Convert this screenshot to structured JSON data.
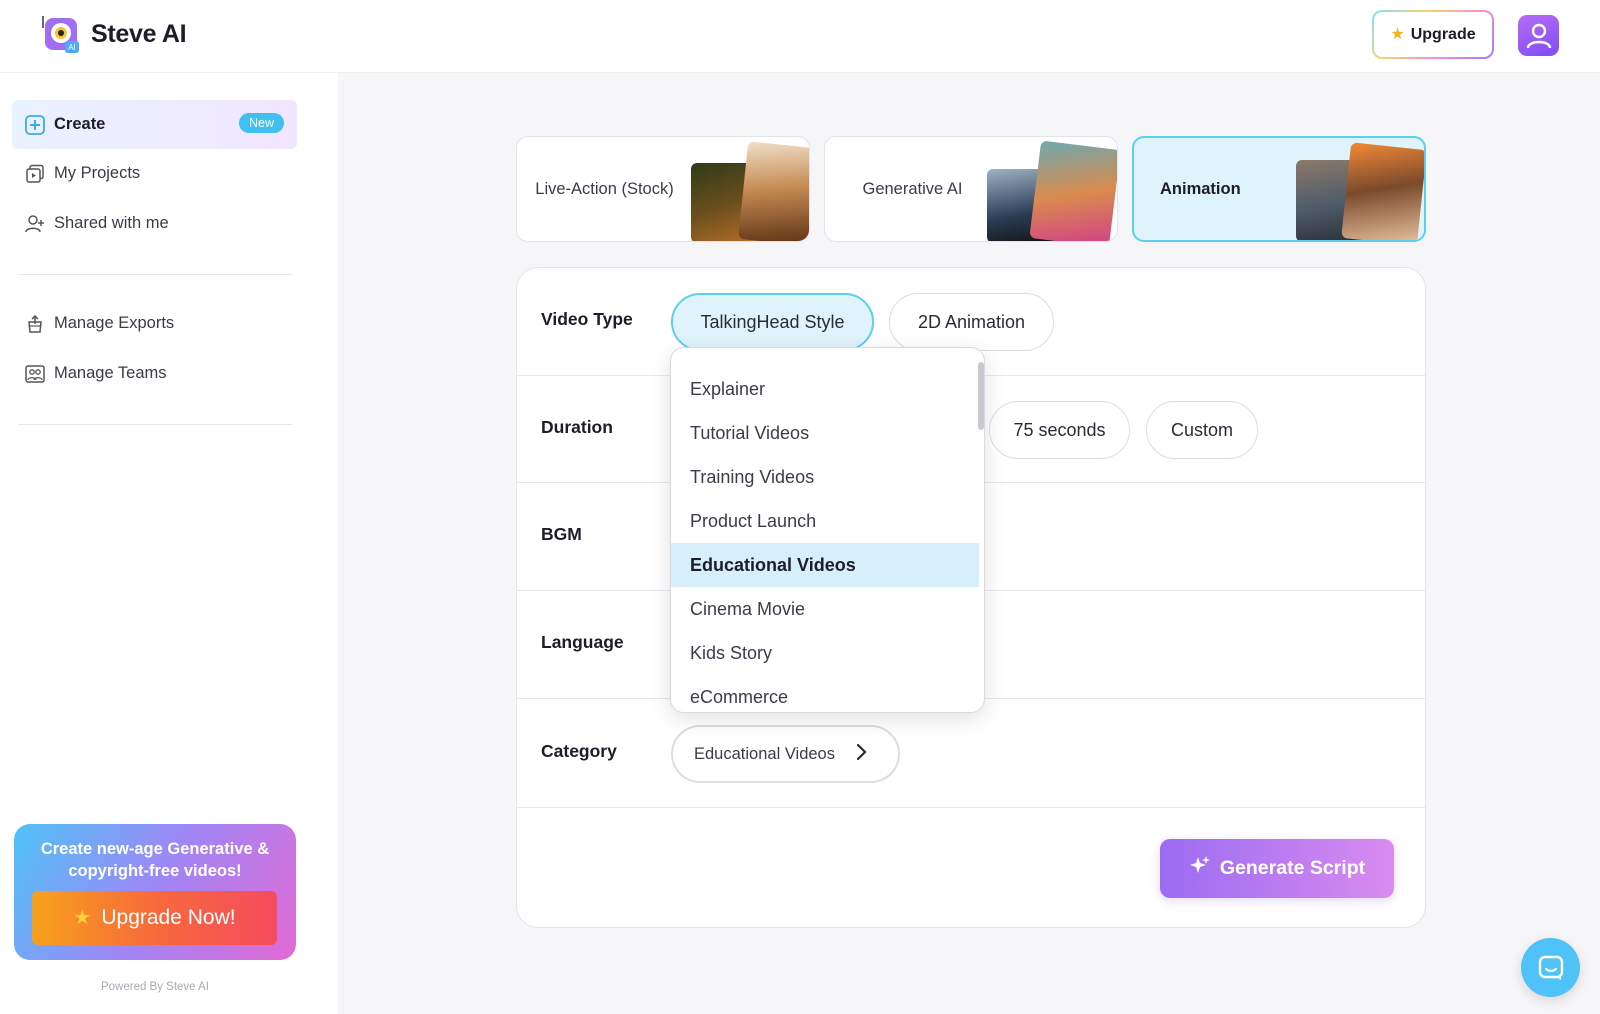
{
  "app": {
    "name": "Steve AI"
  },
  "header": {
    "upgrade_label": "Upgrade"
  },
  "sidebar": {
    "items": [
      {
        "label": "Create",
        "badge": "New"
      },
      {
        "label": "My Projects"
      },
      {
        "label": "Shared with me"
      },
      {
        "label": "Manage Exports"
      },
      {
        "label": "Manage Teams"
      }
    ],
    "promo": {
      "text": "Create new-age Generative & copyright-free videos!",
      "button": "Upgrade Now!"
    },
    "powered_by": "Powered By Steve AI"
  },
  "type_cards": [
    {
      "label": "Live-Action (Stock)",
      "selected": false
    },
    {
      "label": "Generative AI",
      "selected": false
    },
    {
      "label": "Animation",
      "selected": true
    }
  ],
  "form": {
    "rows": [
      "Video Type",
      "Duration",
      "BGM",
      "Language",
      "Category"
    ],
    "video_type_options": [
      {
        "label": "TalkingHead Style",
        "selected": true
      },
      {
        "label": "2D Animation",
        "selected": false
      }
    ],
    "duration_options_visible": [
      "75 seconds",
      "Custom"
    ],
    "category_value": "Educational Videos",
    "generate_button": "Generate Script"
  },
  "category_dropdown": {
    "items": [
      "Explainer",
      "Tutorial Videos",
      "Training Videos",
      "Product Launch",
      "Educational Videos",
      "Cinema Movie",
      "Kids Story",
      "eCommerce"
    ],
    "selected": "Educational Videos"
  },
  "colors": {
    "accent_cyan": "#5ccff0",
    "accent_purple": "#9b6cf2",
    "selected_bg": "#dff3fb"
  }
}
